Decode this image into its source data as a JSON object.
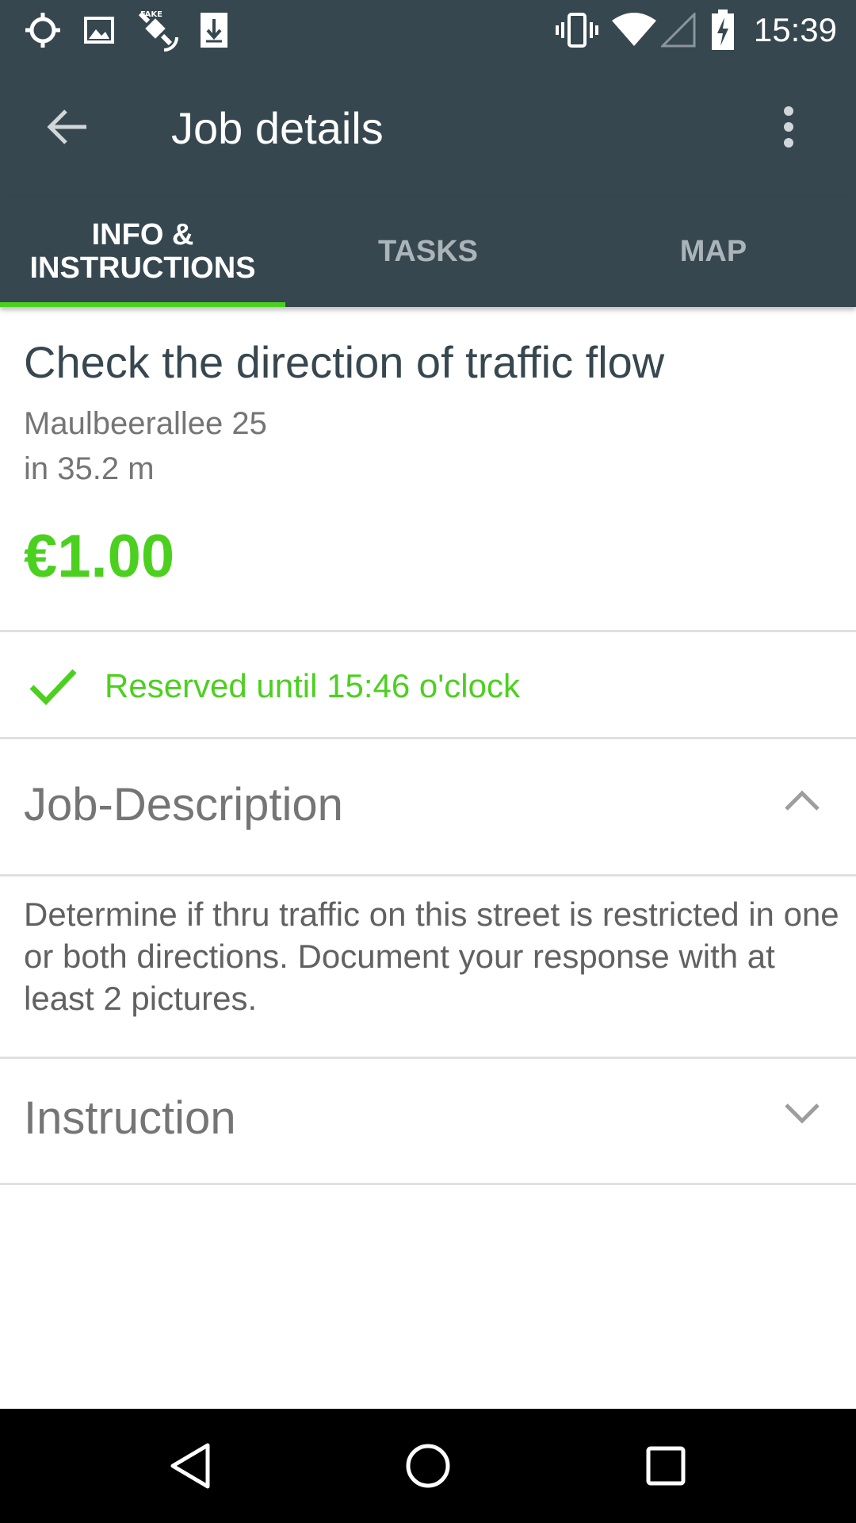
{
  "status_bar": {
    "time": "15:39",
    "left_icons": [
      "gps-icon",
      "image-icon",
      "fake-gps-icon",
      "download-icon"
    ],
    "right_icons": [
      "vibrate-icon",
      "wifi-icon",
      "signal-icon",
      "battery-charging-icon"
    ]
  },
  "app_bar": {
    "title": "Job details",
    "back_icon": "arrow-back-icon",
    "overflow_icon": "more-vert-icon"
  },
  "tabs": [
    {
      "label_line1": "INFO &",
      "label_line2": "INSTRUCTIONS",
      "active": true
    },
    {
      "label_line1": "TASKS",
      "label_line2": "",
      "active": false
    },
    {
      "label_line1": "MAP",
      "label_line2": "",
      "active": false
    }
  ],
  "job": {
    "title": "Check the direction of traffic flow",
    "address": "Maulbeerallee 25",
    "distance": "in 35.2 m",
    "price": "€1.00"
  },
  "reservation": {
    "text": "Reserved until 15:46 o'clock",
    "icon": "check-icon"
  },
  "sections": {
    "description": {
      "title": "Job-Description",
      "expanded": true,
      "body": "Determine if thru traffic on this street is restricted in one or both directions. Document your response with at least 2 pictures."
    },
    "instruction": {
      "title": "Instruction",
      "expanded": false
    }
  },
  "colors": {
    "primary": "#37474f",
    "accent": "#4cd01f",
    "text_secondary": "#757575"
  },
  "nav_bar": {
    "buttons": [
      "back-triangle-icon",
      "home-circle-icon",
      "recents-square-icon"
    ]
  }
}
